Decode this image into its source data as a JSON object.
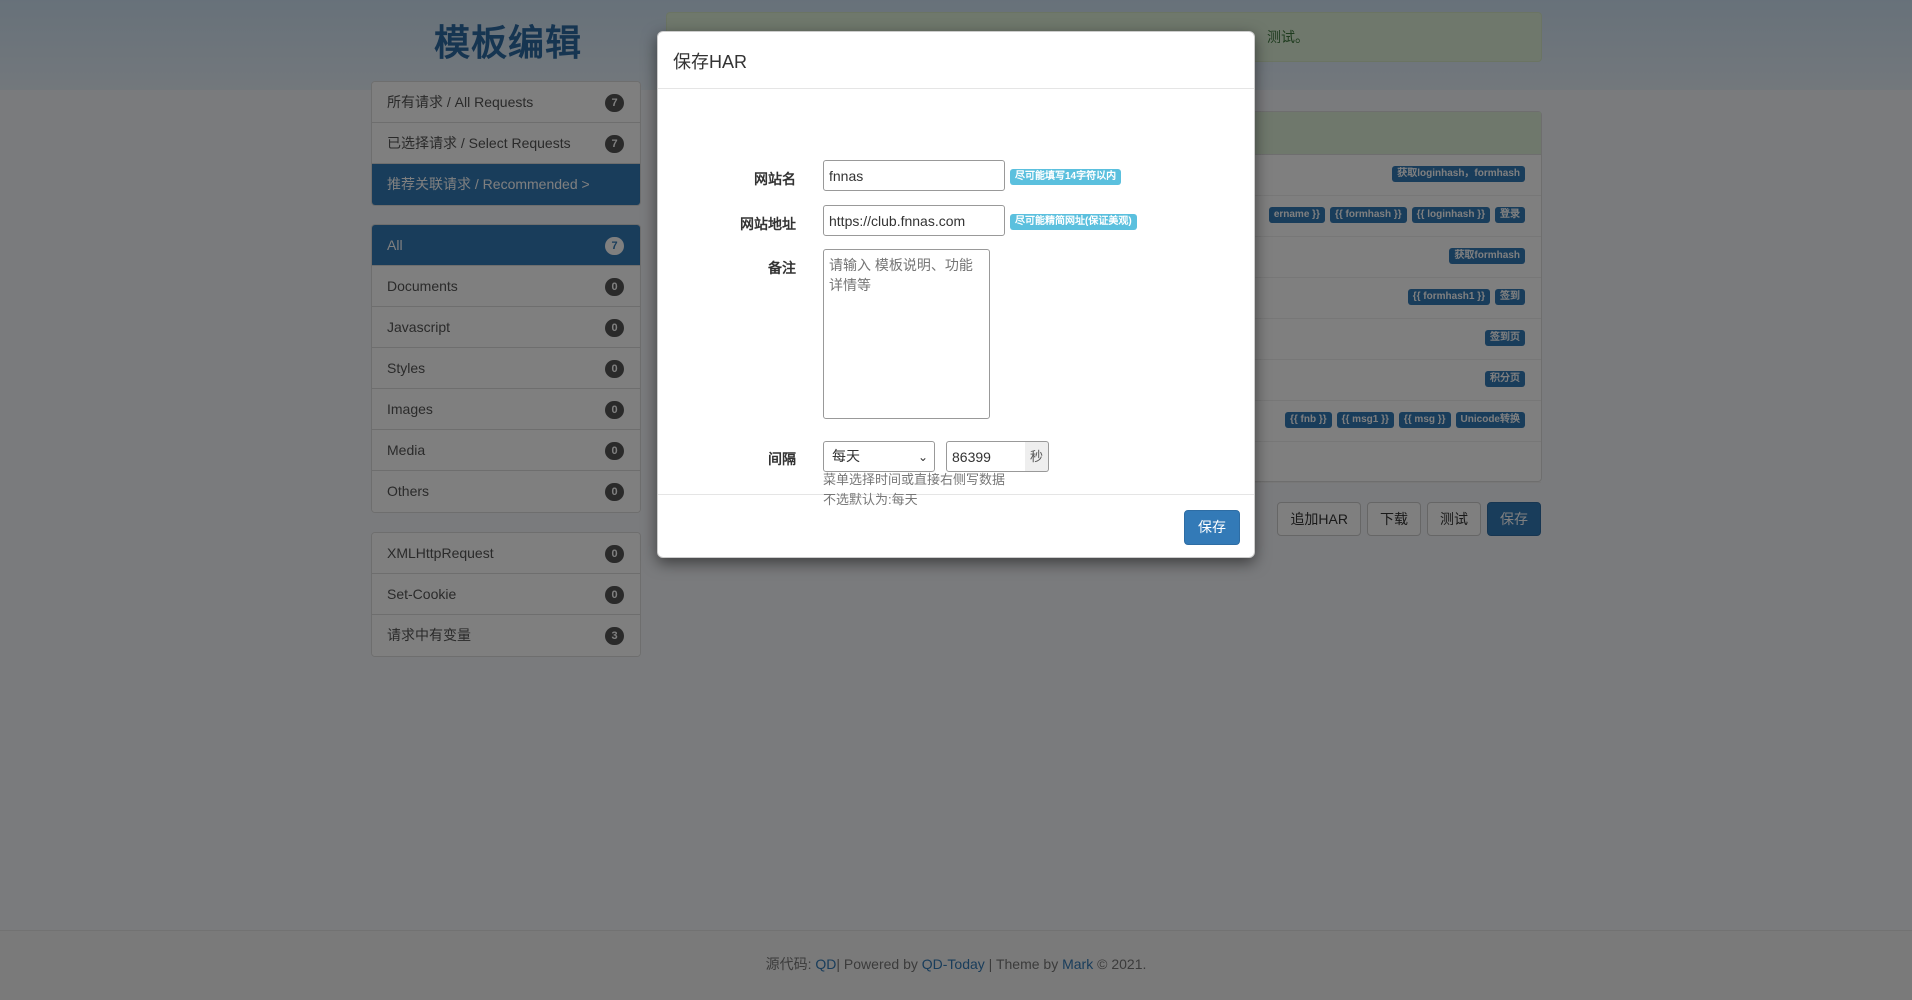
{
  "page": {
    "title": "模板编辑",
    "alert_text": "测试。"
  },
  "sidebar": {
    "group1": [
      {
        "label": "所有请求 / All Requests",
        "count": "7"
      },
      {
        "label": "已选择请求 / Select Requests",
        "count": "7"
      },
      {
        "label": "推荐关联请求 / Recommended >",
        "count": ""
      }
    ],
    "group2": [
      {
        "label": "All",
        "count": "7"
      },
      {
        "label": "Documents",
        "count": "0"
      },
      {
        "label": "Javascript",
        "count": "0"
      },
      {
        "label": "Styles",
        "count": "0"
      },
      {
        "label": "Images",
        "count": "0"
      },
      {
        "label": "Media",
        "count": "0"
      },
      {
        "label": "Others",
        "count": "0"
      }
    ],
    "group3": [
      {
        "label": "XMLHttpRequest",
        "count": "0"
      },
      {
        "label": "Set-Cookie",
        "count": "0"
      },
      {
        "label": "请求中有变量",
        "count": "3"
      }
    ]
  },
  "panel": {
    "rows": [
      {
        "tags": [
          "获取loginhash，formhash"
        ]
      },
      {
        "tags": [
          "ername }}",
          "{{ formhash }}",
          "{{ loginhash }}",
          "登录"
        ]
      },
      {
        "tags": [
          "获取formhash"
        ]
      },
      {
        "tags": [
          "{{ formhash1 }}",
          "签到"
        ]
      },
      {
        "tags": [
          "签到页"
        ]
      },
      {
        "tags": [
          "积分页"
        ]
      },
      {
        "tags": [
          "",
          "{{ fnb }}",
          "{{ msg1 }}",
          "{{ msg }}",
          "Unicode转换"
        ]
      },
      {
        "tags": []
      }
    ]
  },
  "actions": {
    "add_har": "追加HAR",
    "download": "下载",
    "test": "测试",
    "save": "保存"
  },
  "footer": {
    "prefix": "源代码: ",
    "qd": "QD",
    "powered": "| Powered by ",
    "qdtoday": "QD-Today",
    "theme": " | Theme by ",
    "mark": "Mark",
    "year": " © 2021."
  },
  "modal": {
    "title": "保存HAR",
    "site_name_label": "网站名",
    "site_name_value": "fnnas",
    "site_name_hint": "尽可能填写14字符以内",
    "site_url_label": "网站地址",
    "site_url_value": "https://club.fnnas.com",
    "site_url_hint": "尽可能精简网址(保证美观)",
    "note_label": "备注",
    "note_placeholder": "请输入 模板说明、功能详情等",
    "interval_label": "间隔",
    "interval_select": "每天",
    "interval_value": "86399",
    "interval_unit": "秒",
    "help_line1": "菜单选择时间或直接右侧写数据",
    "help_line2": "不选默认为:每天",
    "save_button": "保存"
  }
}
